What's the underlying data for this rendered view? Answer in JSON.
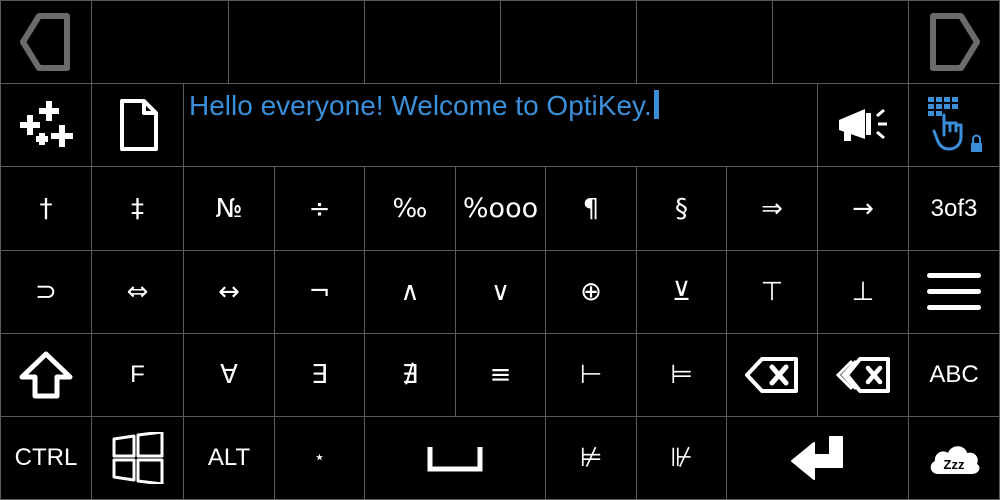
{
  "top_row": {
    "blank_slots": 6
  },
  "scratchpad": {
    "text": "Hello everyone! Welcome to OptiKey."
  },
  "icons": {
    "prev": "previous-page-arrow",
    "next": "next-page-arrow",
    "add": "multi-add-sparkle",
    "doc": "document",
    "speak": "megaphone",
    "keyboard": "keyboard-hand-lock",
    "shift": "shift-arrow",
    "backspace": "backspace",
    "backword": "delete-word",
    "windows": "windows-logo",
    "space": "space-bar",
    "enter": "enter-return",
    "sleep": "sleep-cloud"
  },
  "keys": {
    "row3": [
      "†",
      "‡",
      "№",
      "÷",
      "‰",
      "%ooo",
      "¶",
      "§",
      "⇒",
      "→",
      "3of3"
    ],
    "row4": [
      "⊃",
      "⇔",
      "↔",
      "¬",
      "∧",
      "∨",
      "⊕",
      "⊻",
      "⊤",
      "⊥"
    ],
    "row5": [
      "F",
      "∀",
      "∃",
      "∄",
      "≡",
      "⊢",
      "⊨"
    ],
    "row5_last": "ABC",
    "row6": {
      "ctrl": "CTRL",
      "alt": "ALT",
      "star": "⋆",
      "nmodels": "⊭",
      "nforces": "⊮"
    }
  },
  "colors": {
    "accent": "#3b8fd9",
    "border": "#5a5a5a",
    "background": "#000000",
    "key_text": "#ffffff"
  }
}
